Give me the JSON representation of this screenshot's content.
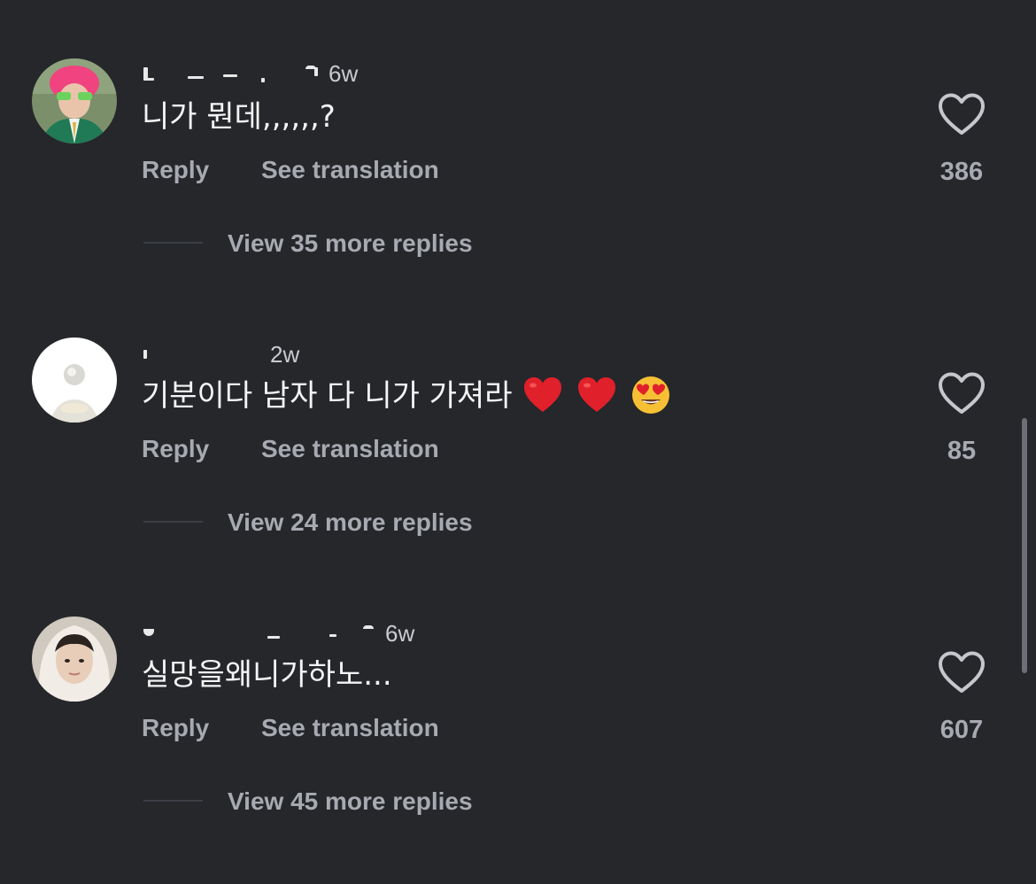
{
  "comments": [
    {
      "time": "6w",
      "text": "니가 뭔데,,,,,,?",
      "emojis": [],
      "reply_label": "Reply",
      "translate_label": "See translation",
      "likes": "386",
      "view_replies": "View 35 more replies"
    },
    {
      "time": "2w",
      "text": "기분이다 남자 다 니가 가져라",
      "emojis": [
        "heart-emoji",
        "heart-emoji",
        "heart-eyes-emoji"
      ],
      "reply_label": "Reply",
      "translate_label": "See translation",
      "likes": "85",
      "view_replies": "View 24 more replies"
    },
    {
      "time": "6w",
      "text": "실망을왜니가하노...",
      "emojis": [],
      "reply_label": "Reply",
      "translate_label": "See translation",
      "likes": "607",
      "view_replies": "View 45 more replies"
    }
  ],
  "icons": {
    "like": "heart-outline-icon"
  },
  "colors": {
    "background": "#25272b",
    "primary_text": "#f4f4f4",
    "secondary_text": "#a7aab0",
    "heart_emoji": "#e0202a"
  }
}
